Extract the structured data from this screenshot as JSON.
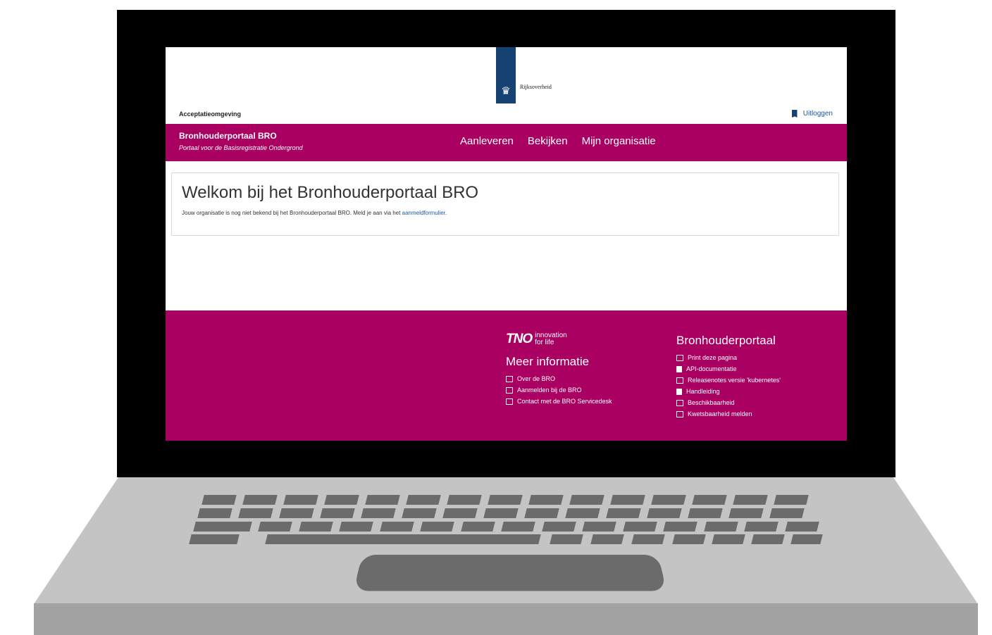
{
  "header": {
    "logo_text": "Rijksoverheid",
    "environment": "Acceptatieomgeving",
    "logout_label": "Uitloggen"
  },
  "navbar": {
    "title": "Bronhouderportaal BRO",
    "subtitle": "Portaal voor de Basisregistratie Ondergrond",
    "menu": [
      "Aanleveren",
      "Bekijken",
      "Mijn organisatie"
    ]
  },
  "main": {
    "heading": "Welkom bij het Bronhouderportaal BRO",
    "text": "Jouw organisatie is nog niet bekend bij het Bronhouderportaal BRO. Meld je aan via het ",
    "link": "aanmeldformulier",
    "text_end": "."
  },
  "footer": {
    "tno_mark": "TNO",
    "tno_tagline_1": "innovation",
    "tno_tagline_2": "for life",
    "meer_title": "Meer informatie",
    "meer_links": [
      {
        "label": "Over de BRO",
        "icon": "external-link-icon"
      },
      {
        "label": "Aanmelden bij de BRO",
        "icon": "external-link-icon"
      },
      {
        "label": "Contact met de BRO Servicedesk",
        "icon": "external-link-icon"
      }
    ],
    "portal_title": "Bronhouderportaal",
    "portal_links": [
      {
        "label": "Print deze pagina",
        "icon": "print-icon"
      },
      {
        "label": "API-documentatie",
        "icon": "document-icon"
      },
      {
        "label": "Releasenotes versie 'kubernetes'",
        "icon": "external-link-icon"
      },
      {
        "label": "Handleiding",
        "icon": "document-icon"
      },
      {
        "label": "Beschikbaarheid",
        "icon": "external-link-icon"
      },
      {
        "label": "Kwetsbaarheid melden",
        "icon": "external-link-icon"
      }
    ]
  },
  "colors": {
    "brand": "#a90061",
    "ribbon": "#154273",
    "link": "#1a5aa0"
  }
}
